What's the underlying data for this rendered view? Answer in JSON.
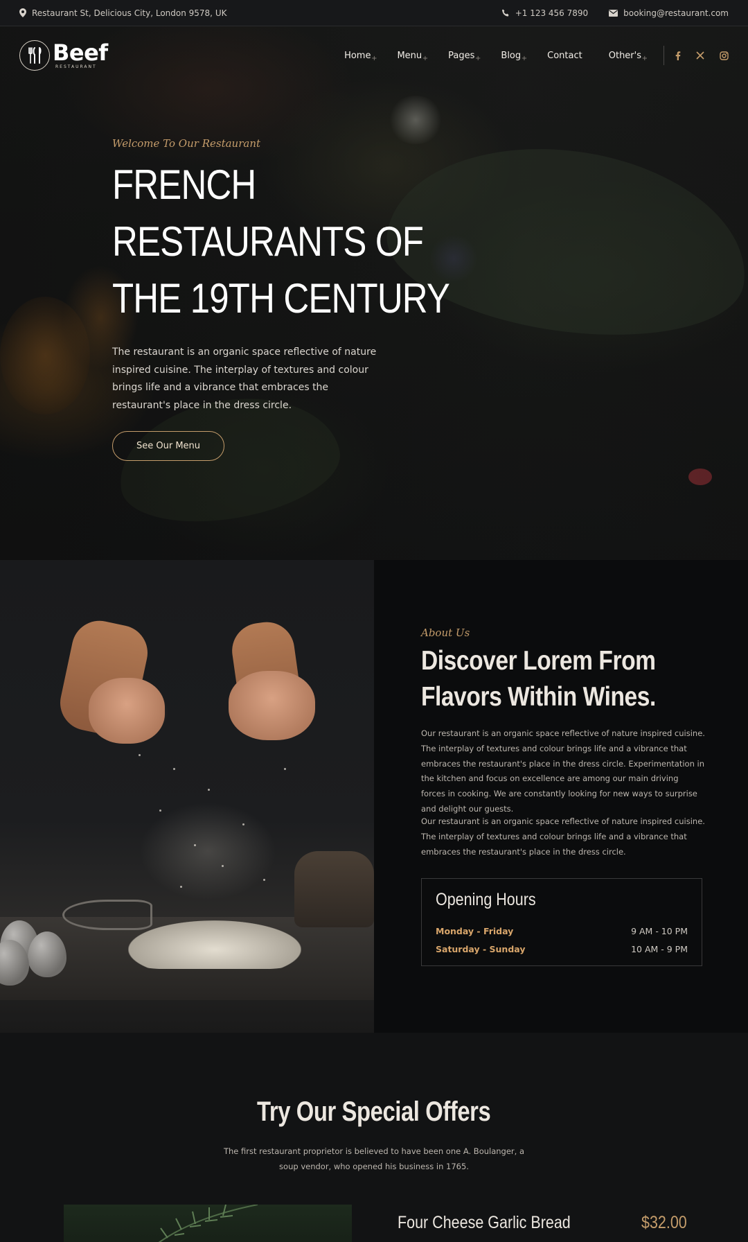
{
  "topbar": {
    "address": "Restaurant St, Delicious City, London 9578, UK",
    "phone": "+1 123 456 7890",
    "email": "booking@restaurant.com"
  },
  "logo": {
    "word": "Beef",
    "sub": "RESTAURANT"
  },
  "nav": {
    "items": [
      {
        "label": "Home"
      },
      {
        "label": "Menu"
      },
      {
        "label": "Pages"
      },
      {
        "label": "Blog"
      },
      {
        "label": "Contact"
      },
      {
        "label": "Other's"
      }
    ],
    "socials": [
      "facebook-icon",
      "x-icon",
      "instagram-icon"
    ]
  },
  "hero": {
    "kicker": "Welcome To Our Restaurant",
    "title_lines": [
      "FRENCH",
      "RESTAURANTS OF",
      "THE 19TH CENTURY"
    ],
    "text": "The restaurant is an organic space reflective of nature inspired cuisine. The interplay of textures and colour brings life and a vibrance that embraces the restaurant's place in the dress circle.",
    "button": "See Our Menu"
  },
  "about": {
    "kicker": "About Us",
    "title_lines": [
      "Discover Lorem From",
      "Flavors Within Wines."
    ],
    "p1": "Our restaurant is an organic space reflective of nature inspired cuisine. The interplay of textures and colour brings life and a vibrance that embraces the restaurant's place in the dress circle. Experimentation in the kitchen and focus on excellence are among our main driving forces in cooking. We are constantly looking for new ways to surprise and delight our guests.",
    "p2": "Our restaurant is an organic space reflective of nature inspired cuisine. The interplay of textures and colour brings life and a vibrance that embraces the restaurant's place in the dress circle.",
    "hours": {
      "title": "Opening Hours",
      "rows": [
        {
          "day": "Monday - Friday",
          "time": "9 AM - 10 PM"
        },
        {
          "day": "Saturday - Sunday",
          "time": "10 AM - 9 PM"
        }
      ]
    }
  },
  "offers": {
    "title": "Try Our Special Offers",
    "text": "The first restaurant proprietor is believed to have been one A. Boulanger, a soup vendor, who opened his business in 1765.",
    "first_item": {
      "name": "Four Cheese Garlic Bread",
      "price": "$32.00"
    }
  },
  "colors": {
    "accent": "#c59d6b",
    "background": "#121314",
    "panel": "#0b0c0d"
  }
}
